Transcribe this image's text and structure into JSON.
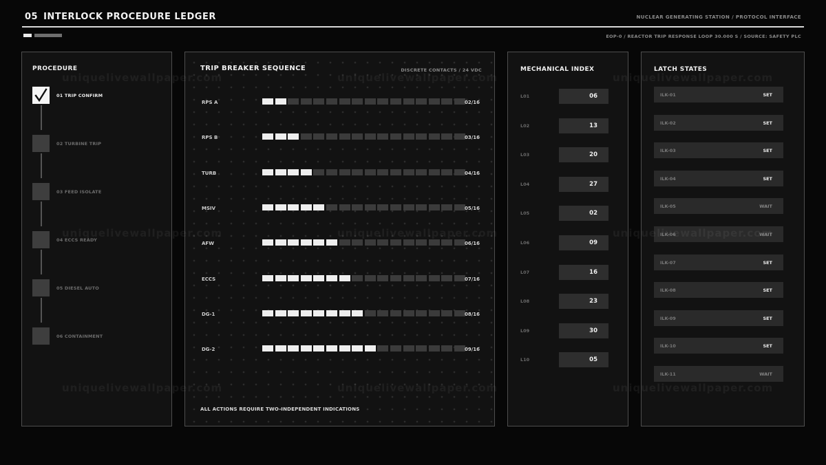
{
  "header": {
    "number": "05",
    "title": "INTERLOCK PROCEDURE LEDGER",
    "right": "NUCLEAR GENERATING STATION / PROTOCOL INTERFACE",
    "subline": "EOP-0 / REACTOR TRIP RESPONSE  LOOP 30.000 S  /  SOURCE: SAFETY PLC"
  },
  "procedure": {
    "title": "PROCEDURE",
    "steps": [
      {
        "label": "01 TRIP CONFIRM",
        "done": true
      },
      {
        "label": "02 TURBINE TRIP",
        "done": false
      },
      {
        "label": "03 FEED ISOLATE",
        "done": false
      },
      {
        "label": "04 ECCS READY",
        "done": false
      },
      {
        "label": "05 DIESEL AUTO",
        "done": false
      },
      {
        "label": "06 CONTAINMENT",
        "done": false
      }
    ]
  },
  "trip": {
    "title": "TRIP BREAKER SEQUENCE",
    "subtitle": "DISCRETE CONTACTS / 24 VDC",
    "total": 16,
    "rows": [
      {
        "label": "RPS A",
        "lit": 2,
        "count": "02/16"
      },
      {
        "label": "RPS B",
        "lit": 3,
        "count": "03/16"
      },
      {
        "label": "TURB",
        "lit": 4,
        "count": "04/16"
      },
      {
        "label": "MSIV",
        "lit": 5,
        "count": "05/16"
      },
      {
        "label": "AFW",
        "lit": 6,
        "count": "06/16"
      },
      {
        "label": "ECCS",
        "lit": 7,
        "count": "07/16"
      },
      {
        "label": "DG-1",
        "lit": 8,
        "count": "08/16"
      },
      {
        "label": "DG-2",
        "lit": 9,
        "count": "09/16"
      }
    ],
    "footer": "ALL ACTIONS REQUIRE TWO-INDEPENDENT INDICATIONS"
  },
  "mech": {
    "title": "MECHANICAL INDEX",
    "rows": [
      {
        "key": "L01",
        "value": "06"
      },
      {
        "key": "L02",
        "value": "13"
      },
      {
        "key": "L03",
        "value": "20"
      },
      {
        "key": "L04",
        "value": "27"
      },
      {
        "key": "L05",
        "value": "02"
      },
      {
        "key": "L06",
        "value": "09"
      },
      {
        "key": "L07",
        "value": "16"
      },
      {
        "key": "L08",
        "value": "23"
      },
      {
        "key": "L09",
        "value": "30"
      },
      {
        "key": "L10",
        "value": "05"
      }
    ]
  },
  "latch": {
    "title": "LATCH STATES",
    "rows": [
      {
        "key": "ILK-01",
        "state": "SET"
      },
      {
        "key": "ILK-02",
        "state": "SET"
      },
      {
        "key": "ILK-03",
        "state": "SET"
      },
      {
        "key": "ILK-04",
        "state": "SET"
      },
      {
        "key": "ILK-05",
        "state": "WAIT"
      },
      {
        "key": "ILK-06",
        "state": "WAIT"
      },
      {
        "key": "ILK-07",
        "state": "SET"
      },
      {
        "key": "ILK-08",
        "state": "SET"
      },
      {
        "key": "ILK-09",
        "state": "SET"
      },
      {
        "key": "ILK-10",
        "state": "SET"
      },
      {
        "key": "ILK-11",
        "state": "WAIT"
      }
    ]
  },
  "watermark": "uniquelivewallpaper.com"
}
